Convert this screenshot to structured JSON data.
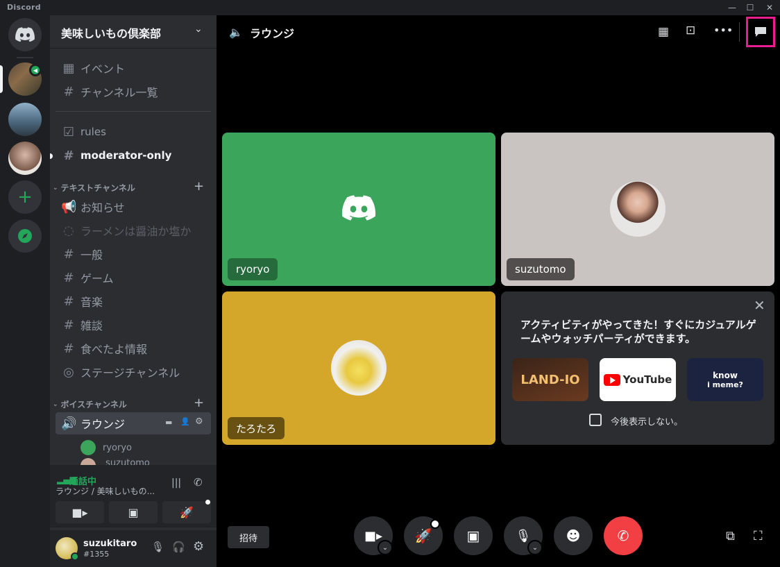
{
  "app": {
    "title": "Discord"
  },
  "window": {
    "minimize": "—",
    "maximize": "☐",
    "close": "✕"
  },
  "guild": {
    "name": "美味しいもの倶楽部"
  },
  "nav": {
    "events": "イベント",
    "channel_list": "チャンネル一覧"
  },
  "pinned_channels": [
    {
      "name": "rules"
    },
    {
      "name": "moderator-only"
    }
  ],
  "text_category": {
    "label": "テキストチャンネル"
  },
  "text_channels": [
    {
      "name": "お知らせ"
    },
    {
      "name": "ラーメンは醤油か塩か"
    },
    {
      "name": "一般"
    },
    {
      "name": "ゲーム"
    },
    {
      "name": "音楽"
    },
    {
      "name": "雑談"
    },
    {
      "name": "食べたよ情報"
    },
    {
      "name": "ステージチャンネル"
    }
  ],
  "voice_category": {
    "label": "ボイスチャンネル"
  },
  "voice_channel": {
    "name": "ラウンジ",
    "members": [
      "ryoryo",
      "suzutomo"
    ]
  },
  "call_status": {
    "status": "通話中",
    "location": "ラウンジ / 美味しいもの..."
  },
  "user": {
    "name": "suzukitaro",
    "tag": "#1355"
  },
  "header": {
    "channel": "ラウンジ"
  },
  "tiles": [
    {
      "name": "ryoryo",
      "bg": "#3ba55c"
    },
    {
      "name": "suzutomo",
      "bg": "#c9c4c1"
    },
    {
      "name": "たろたろ",
      "bg": "#d4a62a"
    }
  ],
  "activity": {
    "message": "アクティビティがやってきた！すぐにカジュアルゲームやウォッチパーティができます。",
    "cards": [
      {
        "label": "LAND-IO"
      },
      {
        "label": "YouTube"
      },
      {
        "label_top": "know",
        "label_bottom": "i meme?"
      }
    ],
    "dont_show": "今後表示しない。"
  },
  "invite_label": "招待",
  "colors": {
    "accent_red": "#f23f43",
    "green": "#23a55a",
    "highlight_pink": "#e91e8c"
  }
}
